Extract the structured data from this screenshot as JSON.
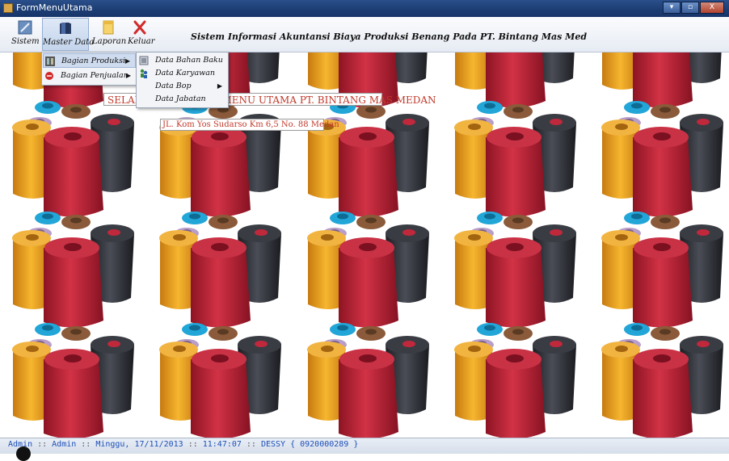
{
  "window": {
    "title": "FormMenuUtama",
    "buttons": {
      "minimize": "▾",
      "maximize": "▫",
      "close": "X"
    }
  },
  "toolbar": {
    "items": [
      {
        "label": "Sistem",
        "icon": "system-icon"
      },
      {
        "label": "Master Data",
        "icon": "book-icon"
      },
      {
        "label": "Laporan",
        "icon": "report-icon"
      },
      {
        "label": "Keluar",
        "icon": "exit-icon"
      }
    ],
    "heading": "Sistem Informasi Akuntansi Biaya Produksi Benang Pada PT. Bintang Mas Med"
  },
  "menu": {
    "master_data": [
      {
        "label": "Bagian Produksi",
        "icon": "production-icon",
        "has_submenu": true
      },
      {
        "label": "Bagian Penjualan",
        "icon": "sales-icon",
        "has_submenu": true
      }
    ],
    "produksi_submenu": [
      {
        "label": "Data Bahan Baku",
        "icon": "materials-icon",
        "has_submenu": false
      },
      {
        "label": "Data Karyawan",
        "icon": "employees-icon",
        "has_submenu": false
      },
      {
        "label": "Data Bop",
        "icon": "",
        "has_submenu": true
      },
      {
        "label": "Data Jabatan",
        "icon": "",
        "has_submenu": false
      }
    ]
  },
  "banner": {
    "welcome": "SELAMAT DATANG DI MENU UTAMA PT. BINTANG MAS MEDAN",
    "address": "JL. Kom Yos Sudarso Km 6,5 No. 88 Medan"
  },
  "status": {
    "user": "Admin",
    "role": "Admin",
    "date": "Minggu, 17/11/2013",
    "time": "11:47:07",
    "operator": "DESSY { 0920000289 }",
    "separator": "::"
  },
  "colors": {
    "titlebar": "#1c3d73",
    "accent_text": "#c0392b",
    "status_text": "#1d4fb8",
    "spool_orange": "#f0a020",
    "spool_red": "#c0283c",
    "spool_dark": "#34363d",
    "spool_blue": "#22a6d8",
    "spool_brown": "#8a5a3a",
    "spool_lilac": "#b89ec8"
  }
}
